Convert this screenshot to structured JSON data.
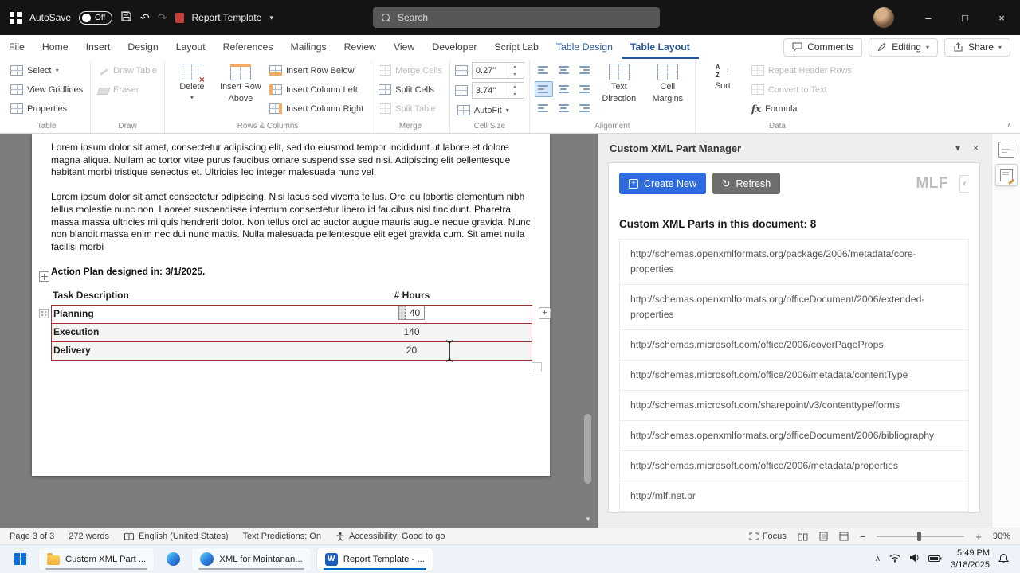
{
  "titlebar": {
    "autosave_label": "AutoSave",
    "autosave_state": "Off",
    "doc_title": "Report Template",
    "search_placeholder": "Search"
  },
  "glyphs": {
    "dropdown": "▾",
    "undo": "↶",
    "redo": "↷",
    "minimize": "–",
    "maximize": "□",
    "close": "×",
    "plus": "+",
    "refresh": "↻",
    "chevron_left": "‹",
    "chevron_up": "∧",
    "scroll_down": "▾",
    "spin_up": "▴",
    "spin_down": "▾",
    "formula": "fx",
    "sort_a": "A",
    "sort_z": "Z",
    "arrow_down": "↓",
    "zoom_minus": "−",
    "zoom_plus": "+"
  },
  "ribbon": {
    "tabs": [
      "File",
      "Home",
      "Insert",
      "Design",
      "Layout",
      "References",
      "Mailings",
      "Review",
      "View",
      "Developer",
      "Script Lab",
      "Table Design",
      "Table Layout"
    ],
    "comments": "Comments",
    "editing": "Editing",
    "share": "Share",
    "groups": {
      "table": {
        "label": "Table",
        "select": "Select",
        "view_gridlines": "View Gridlines",
        "properties": "Properties"
      },
      "draw": {
        "label": "Draw",
        "draw_table": "Draw Table",
        "eraser": "Eraser"
      },
      "rows_columns": {
        "label": "Rows & Columns",
        "delete": "Delete",
        "insert_row_above_line1": "Insert Row",
        "insert_row_above_line2": "Above",
        "insert_row_below": "Insert Row Below",
        "insert_column_left": "Insert Column Left",
        "insert_column_right": "Insert Column Right"
      },
      "merge": {
        "label": "Merge",
        "merge_cells": "Merge Cells",
        "split_cells": "Split Cells",
        "split_table": "Split Table"
      },
      "cell_size": {
        "label": "Cell Size",
        "height_value": "0.27\"",
        "width_value": "3.74\"",
        "autofit": "AutoFit"
      },
      "alignment": {
        "label": "Alignment",
        "text_direction_line1": "Text",
        "text_direction_line2": "Direction",
        "cell_margins_line1": "Cell",
        "cell_margins_line2": "Margins"
      },
      "data": {
        "label": "Data",
        "sort": "Sort",
        "repeat_header_rows": "Repeat Header Rows",
        "convert_to_text": "Convert to Text",
        "formula": "Formula"
      }
    }
  },
  "document": {
    "paragraph1": "Lorem ipsum dolor sit amet, consectetur adipiscing elit, sed do eiusmod tempor incididunt ut labore et dolore magna aliqua. Nullam ac tortor vitae purus faucibus ornare suspendisse sed nisi. Adipiscing elit pellentesque habitant morbi tristique senectus et. Ultricies leo integer malesuada nunc vel.",
    "paragraph2": "Lorem ipsum dolor sit amet consectetur adipiscing. Nisi lacus sed viverra tellus. Orci eu lobortis elementum nibh tellus molestie nunc non. Laoreet suspendisse interdum consectetur libero id faucibus nisl tincidunt. Pharetra massa massa ultricies mi quis hendrerit dolor. Non tellus orci ac auctor augue mauris augue neque gravida. Nunc non blandit massa enim nec dui nunc mattis. Nulla malesuada pellentesque elit eget gravida cum. Sit amet nulla facilisi morbi",
    "action_plan_heading": "Action Plan designed in: 3/1/2025.",
    "table": {
      "header_task": "Task Description",
      "header_hours": "# Hours",
      "rows": [
        {
          "task": "Planning",
          "hours": "40"
        },
        {
          "task": "Execution",
          "hours": "140"
        },
        {
          "task": "Delivery",
          "hours": "20"
        }
      ]
    }
  },
  "xml_panel": {
    "title": "Custom XML Part Manager",
    "create_new": "Create New",
    "refresh": "Refresh",
    "logo": "MLF",
    "heading": "Custom XML Parts in this document: 8",
    "parts": [
      "http://schemas.openxmlformats.org/package/2006/metadata/core-properties",
      "http://schemas.openxmlformats.org/officeDocument/2006/extended-properties",
      "http://schemas.microsoft.com/office/2006/coverPageProps",
      "http://schemas.microsoft.com/office/2006/metadata/contentType",
      "http://schemas.microsoft.com/sharepoint/v3/contenttype/forms",
      "http://schemas.openxmlformats.org/officeDocument/2006/bibliography",
      "http://schemas.microsoft.com/office/2006/metadata/properties",
      "http://mlf.net.br"
    ]
  },
  "status_bar": {
    "page": "Page 3 of 3",
    "words": "272 words",
    "language": "English (United States)",
    "predictions": "Text Predictions: On",
    "accessibility": "Accessibility: Good to go",
    "focus": "Focus",
    "zoom": "90%"
  },
  "taskbar": {
    "items": [
      {
        "label": "Custom XML Part ..."
      },
      {
        "label": "XML for Maintanan..."
      },
      {
        "label": "Report Template - ..."
      }
    ],
    "time": "5:49 PM",
    "date": "3/18/2025"
  }
}
